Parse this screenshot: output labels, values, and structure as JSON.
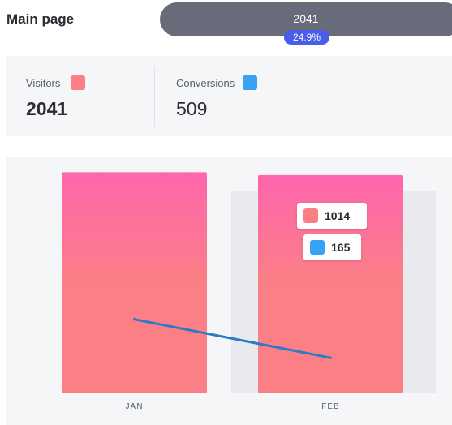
{
  "page": {
    "title": "Main page"
  },
  "funnel": {
    "total": "2041",
    "rate": "24.9%"
  },
  "summary": {
    "visitors": {
      "label": "Visitors",
      "value": "2041",
      "color": "#fb7f85"
    },
    "conversions": {
      "label": "Conversions",
      "value": "509",
      "color": "#37a2f4"
    }
  },
  "tooltip": {
    "visitors_value": "1014",
    "conversions_value": "165"
  },
  "chart_data": {
    "type": "bar",
    "categories": [
      "JAN",
      "FEB"
    ],
    "series": [
      {
        "name": "Visitors",
        "values": [
          1027,
          1014
        ],
        "color": "#fb7f85",
        "gradient_top": "#fe66ad"
      },
      {
        "name": "Conversions",
        "values": [
          344,
          165
        ],
        "color": "#2d7bc7"
      }
    ],
    "highlighted_category": "FEB",
    "ylim": [
      0,
      1100
    ],
    "grid": false
  }
}
